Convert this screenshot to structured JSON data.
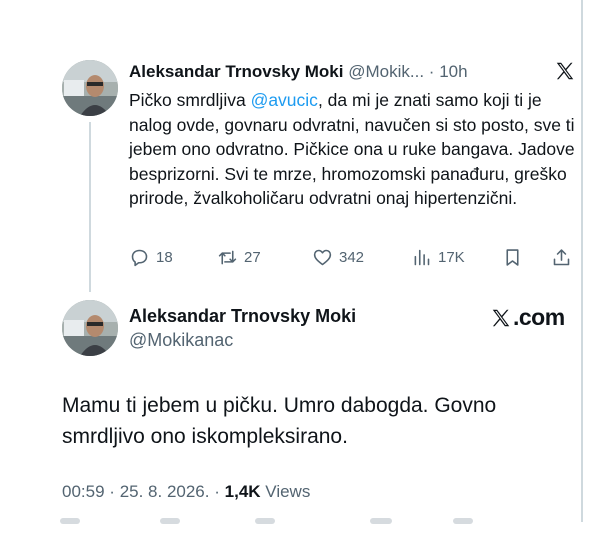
{
  "reply_tweet": {
    "display_name": "Aleksandar Trnovsky Moki",
    "handle_truncated": "@Mokik...",
    "separator": "·",
    "time_ago": "10h",
    "text_before_mention": "Pičko smrdljiva ",
    "mention": "@avucic",
    "text_after_mention": ", da mi je znati samo koji ti je nalog ovde, govnaru odvratni, navučen si sto posto, sve ti jebem ono odvratno. Pičkice ona u ruke bangava. Jadove besprizorni. Svi te mrze, hromozomski panađuru, greško prirode, žvalkoholičaru odvratni onaj hipertenzični.",
    "actions": {
      "replies": "18",
      "reposts": "27",
      "likes": "342",
      "views": "17K"
    },
    "icons": [
      "x-logo-icon",
      "reply-icon",
      "repost-icon",
      "like-icon",
      "views-icon",
      "bookmark-icon",
      "share-icon"
    ]
  },
  "main_tweet": {
    "display_name": "Aleksandar Trnovsky Moki",
    "handle": "@Mokikanac",
    "watermark": ".com",
    "text": "Mamu ti jebem u pičku. Umro dabogda. Govno smrdljivo ono iskompleksirano.",
    "time": "00:59",
    "date": "25. 8. 2026.",
    "separator": "·",
    "views_count": "1,4K",
    "views_label": "Views"
  },
  "colors": {
    "text": "#0f1419",
    "muted": "#536471",
    "link": "#1d9bf0",
    "divider": "#cfd9de"
  }
}
